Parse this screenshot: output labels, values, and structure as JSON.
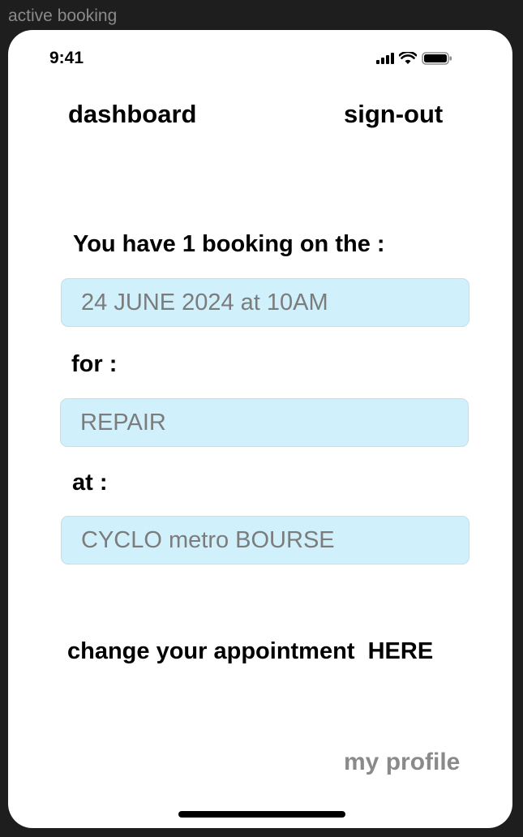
{
  "frame": {
    "title": "active booking"
  },
  "status_bar": {
    "time": "9:41"
  },
  "nav": {
    "dashboard": "dashboard",
    "sign_out": "sign-out"
  },
  "booking": {
    "intro": "You have 1 booking on the :",
    "date_value": "24 JUNE 2024 at 10AM",
    "for_label": "for :",
    "service_value": "REPAIR",
    "at_label": "at :",
    "location_value": "CYCLO metro BOURSE"
  },
  "change": {
    "text": "change your appointment  HERE"
  },
  "footer": {
    "profile": "my profile"
  },
  "colors": {
    "field_bg": "#d0f0fb",
    "field_text": "#7c7c7c",
    "muted_link": "#8a8a8a"
  }
}
